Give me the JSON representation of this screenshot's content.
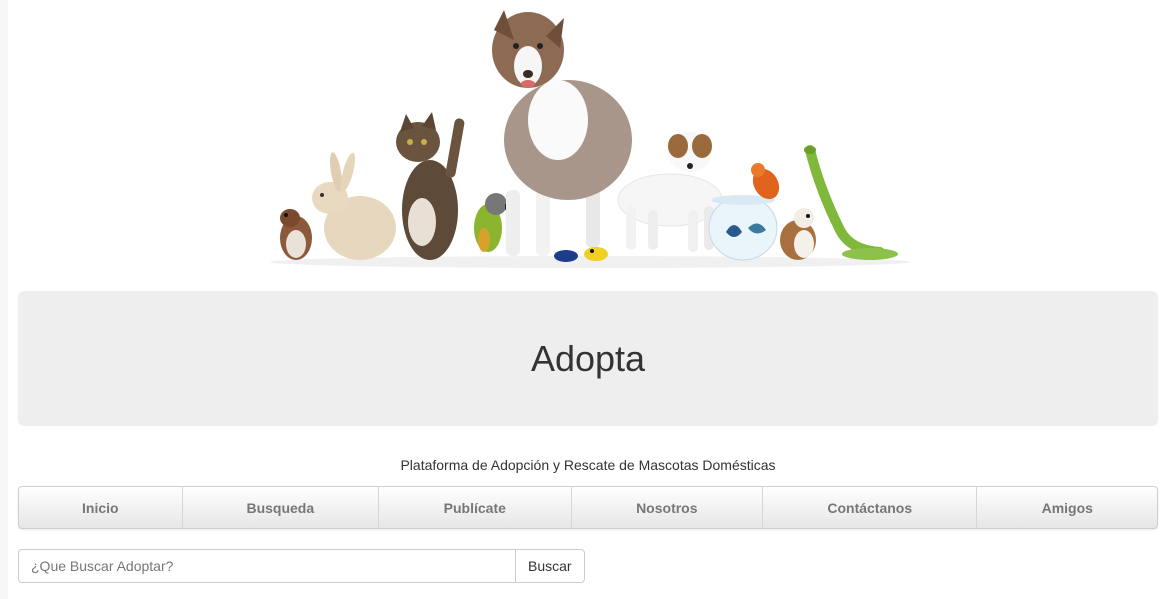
{
  "header": {
    "banner_alt": "animals-banner",
    "title": "Adopta",
    "tagline": "Plataforma de Adopción y Rescate de Mascotas Domésticas"
  },
  "nav": {
    "items": [
      {
        "label": "Inicio"
      },
      {
        "label": "Busqueda"
      },
      {
        "label": "Publícate"
      },
      {
        "label": "Nosotros"
      },
      {
        "label": "Contáctanos"
      },
      {
        "label": "Amigos"
      }
    ]
  },
  "search": {
    "placeholder": "¿Que Buscar Adoptar?",
    "value": "",
    "button_label": "Buscar"
  },
  "colors": {
    "jumbotron_bg": "#eeeeee",
    "nav_text": "#777777",
    "title_text": "#333333"
  }
}
